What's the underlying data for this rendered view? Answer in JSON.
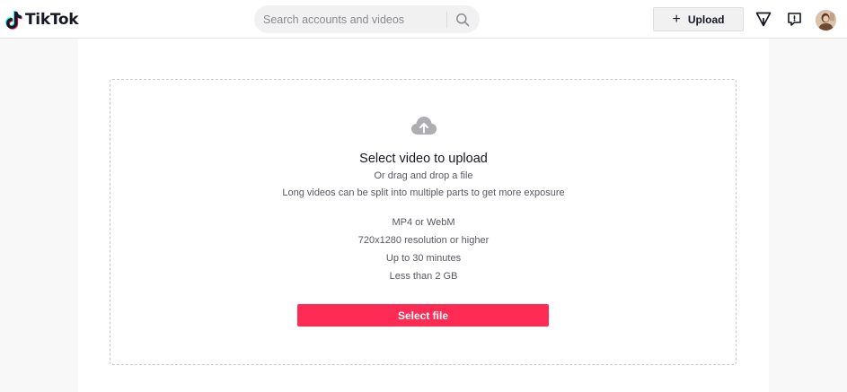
{
  "header": {
    "logo_text": "TikTok",
    "search": {
      "placeholder": "Search accounts and videos",
      "value": ""
    },
    "upload_label": "Upload",
    "icons": [
      "tiktok-logo-icon",
      "search-icon",
      "plus-icon",
      "filter-icon",
      "messages-icon",
      "avatar"
    ]
  },
  "upload": {
    "title": "Select video to upload",
    "subtitle": "Or drag and drop a file",
    "hint": "Long videos can be split into multiple parts to get more exposure",
    "specs": [
      "MP4 or WebM",
      "720x1280 resolution or higher",
      "Up to 30 minutes",
      "Less than 2 GB"
    ],
    "button_label": "Select file",
    "icon": "cloud-upload-icon"
  },
  "colors": {
    "accent": "#fe2c55",
    "text": "#161823",
    "muted": "#575861",
    "background": "#f8f8f8"
  }
}
